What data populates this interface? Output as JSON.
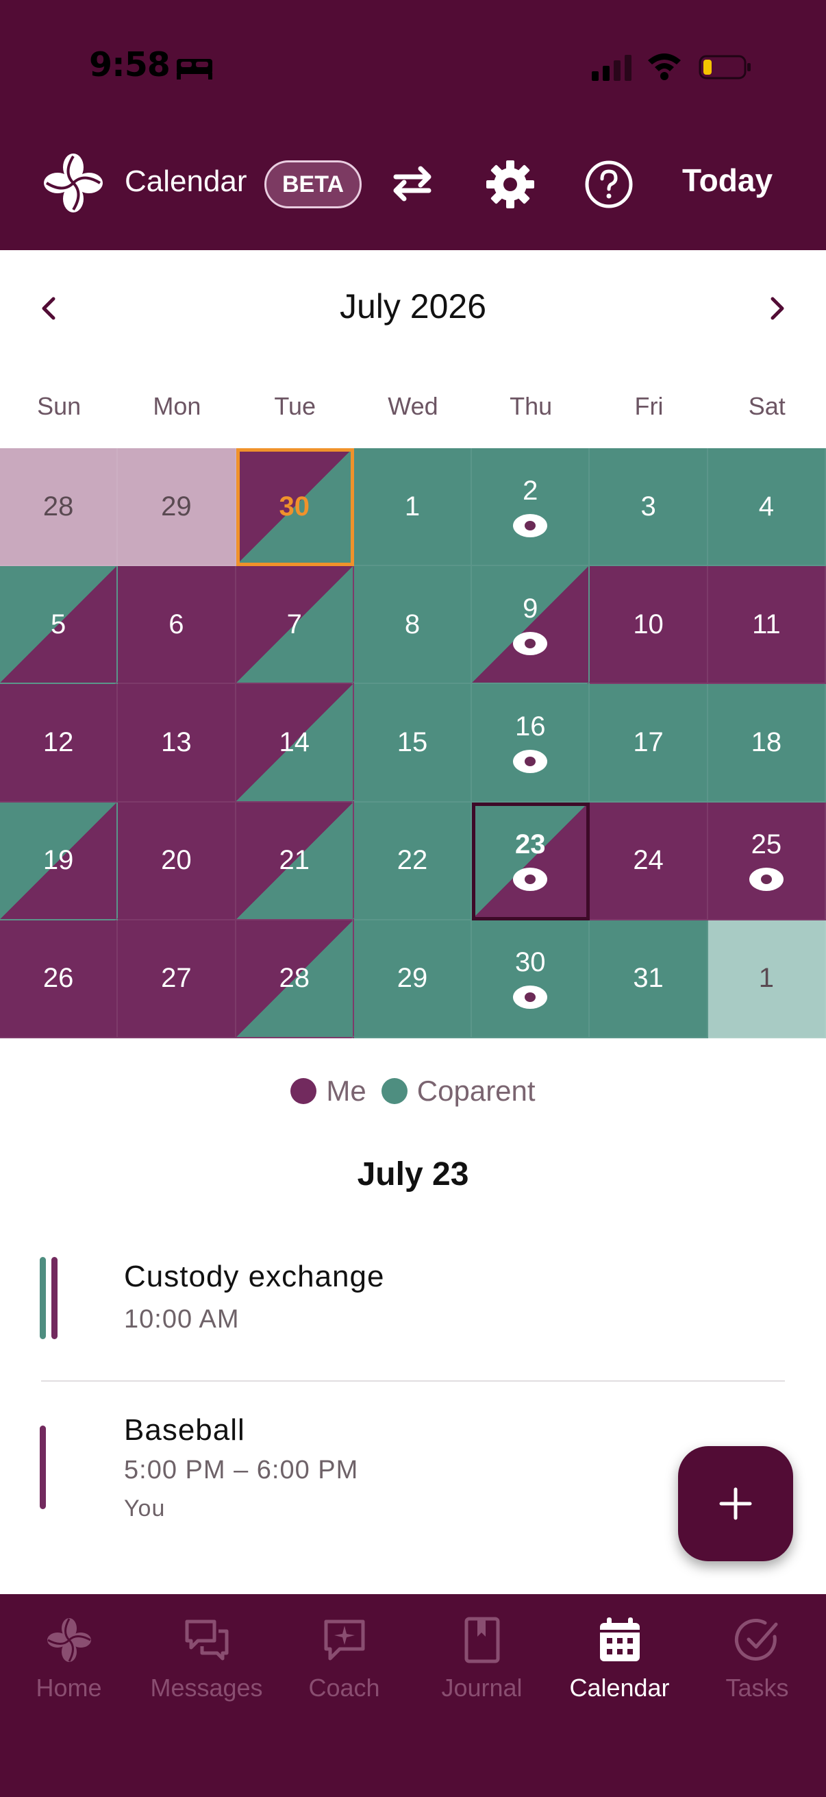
{
  "status_bar": {
    "time": "9:58"
  },
  "header": {
    "title": "Calendar",
    "badge": "BETA",
    "today_label": "Today",
    "icons": [
      "logo-icon",
      "swap-icon",
      "gear-icon",
      "help-icon"
    ]
  },
  "month": {
    "title": "July 2026"
  },
  "weekdays": [
    "Sun",
    "Mon",
    "Tue",
    "Wed",
    "Thu",
    "Fri",
    "Sat"
  ],
  "colors": {
    "me": "#722a5e",
    "coparent": "#4e8e80",
    "primary": "#520c35",
    "today_outline": "#f0922b"
  },
  "days": [
    {
      "label": "28",
      "type": "prev"
    },
    {
      "label": "29",
      "type": "prev"
    },
    {
      "label": "30",
      "type": "split-me-co",
      "today": true
    },
    {
      "label": "1",
      "type": "co"
    },
    {
      "label": "2",
      "type": "co",
      "event": true
    },
    {
      "label": "3",
      "type": "co"
    },
    {
      "label": "4",
      "type": "co"
    },
    {
      "label": "5",
      "type": "split-co-me"
    },
    {
      "label": "6",
      "type": "me"
    },
    {
      "label": "7",
      "type": "split-me-co"
    },
    {
      "label": "8",
      "type": "co"
    },
    {
      "label": "9",
      "type": "split-co-me",
      "event": true
    },
    {
      "label": "10",
      "type": "me"
    },
    {
      "label": "11",
      "type": "me"
    },
    {
      "label": "12",
      "type": "me"
    },
    {
      "label": "13",
      "type": "me"
    },
    {
      "label": "14",
      "type": "split-me-co"
    },
    {
      "label": "15",
      "type": "co"
    },
    {
      "label": "16",
      "type": "co",
      "event": true
    },
    {
      "label": "17",
      "type": "co"
    },
    {
      "label": "18",
      "type": "co"
    },
    {
      "label": "19",
      "type": "split-co-me"
    },
    {
      "label": "20",
      "type": "me"
    },
    {
      "label": "21",
      "type": "split-me-co"
    },
    {
      "label": "22",
      "type": "co"
    },
    {
      "label": "23",
      "type": "split-co-me",
      "event": true,
      "selected": true
    },
    {
      "label": "24",
      "type": "me"
    },
    {
      "label": "25",
      "type": "me",
      "event": true
    },
    {
      "label": "26",
      "type": "me"
    },
    {
      "label": "27",
      "type": "me"
    },
    {
      "label": "28",
      "type": "split-me-co"
    },
    {
      "label": "29",
      "type": "co"
    },
    {
      "label": "30",
      "type": "co",
      "event": true
    },
    {
      "label": "31",
      "type": "co"
    },
    {
      "label": "1",
      "type": "next"
    }
  ],
  "legend": {
    "me": "Me",
    "coparent": "Coparent"
  },
  "selected_day": {
    "title": "July 23",
    "events": [
      {
        "title": "Custody exchange",
        "time": "10:00 AM"
      },
      {
        "title": "Baseball",
        "time": "5:00 PM – 6:00 PM",
        "who": "You"
      }
    ]
  },
  "bottom_nav": [
    {
      "label": "Home",
      "icon": "home-icon"
    },
    {
      "label": "Messages",
      "icon": "messages-icon"
    },
    {
      "label": "Coach",
      "icon": "coach-icon"
    },
    {
      "label": "Journal",
      "icon": "journal-icon"
    },
    {
      "label": "Calendar",
      "icon": "calendar-icon",
      "active": true
    },
    {
      "label": "Tasks",
      "icon": "tasks-icon"
    }
  ]
}
